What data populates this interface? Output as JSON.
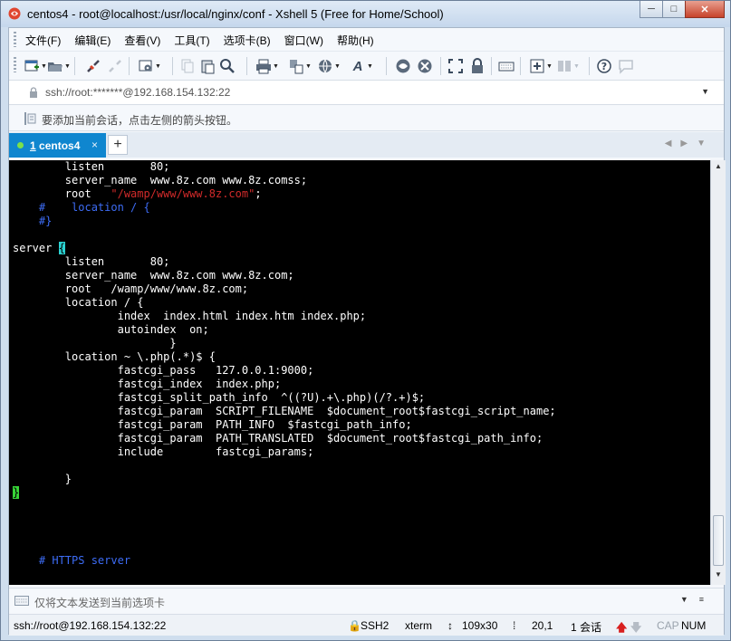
{
  "window": {
    "title": "centos4 - root@localhost:/usr/local/nginx/conf - Xshell 5 (Free for Home/School)",
    "min_label": "─",
    "max_label": "□",
    "close_label": "✕"
  },
  "menu": {
    "items": [
      "文件(F)",
      "编辑(E)",
      "查看(V)",
      "工具(T)",
      "选项卡(B)",
      "窗口(W)",
      "帮助(H)"
    ]
  },
  "address": {
    "text": "ssh://root:*******@192.168.154.132:22"
  },
  "session_hint": "要添加当前会话，点击左侧的箭头按钮。",
  "tabs": {
    "active_number": "1",
    "active_label": " centos4",
    "close": "×",
    "new_tab": "+"
  },
  "terminal": {
    "lines": [
      "        listen       80;",
      "        server_name  www.8z.com www.8z.comss;",
      "        root   ",
      "    #    location / {",
      "    #}",
      "",
      "server ",
      "        listen       80;",
      "        server_name  www.8z.com www.8z.com;",
      "        root   /wamp/www/www.8z.com;",
      "        location / {",
      "                index  index.html index.htm index.php;",
      "                autoindex  on;",
      "                        }",
      "        location ~ \\.php(.*)$ {",
      "                fastcgi_pass   127.0.0.1:9000;",
      "                fastcgi_index  index.php;",
      "                fastcgi_split_path_info  ^((?U).+\\.php)(/?.+)$;",
      "                fastcgi_param  SCRIPT_FILENAME  $document_root$fastcgi_script_name;",
      "                fastcgi_param  PATH_INFO  $fastcgi_path_info;",
      "                fastcgi_param  PATH_TRANSLATED  $document_root$fastcgi_path_info;",
      "                include        fastcgi_params;",
      "",
      "        }",
      "",
      "",
      "",
      "",
      "",
      "    # HTTPS server"
    ],
    "root_string": "\"/wamp/www/www.8z.com\"",
    "root_semicolon": ";",
    "server_brace": "{",
    "closing_brace": "}"
  },
  "send_bar": {
    "placeholder": "仅将文本发送到当前选项卡"
  },
  "status": {
    "connection": "ssh://root@192.168.154.132:22",
    "protocol": "SSH2",
    "term": "xterm",
    "size": "109x30",
    "cursor": "20,1",
    "sessions": "1 会话",
    "caps": "CAP",
    "num": "NUM"
  },
  "colors": {
    "tab_active": "#0f86cf",
    "terminal_bg": "#000000",
    "comment_blue": "#3d6cf5",
    "string_red": "#d12a2a",
    "cursor_green": "#37d337",
    "bracket_cyan": "#2bd2d2"
  },
  "icons": [
    "new-session-icon",
    "open-icon",
    "connect-icon",
    "disconnect-icon",
    "properties-icon",
    "copy-icon",
    "paste-icon",
    "find-icon",
    "print-icon",
    "transfer-icon",
    "globe-icon",
    "font-icon",
    "xftp-icon",
    "xmanager-icon",
    "fullscreen-icon",
    "lock-icon",
    "keyboard-icon",
    "add-icon",
    "layout-icon",
    "help-icon",
    "chat-icon"
  ]
}
